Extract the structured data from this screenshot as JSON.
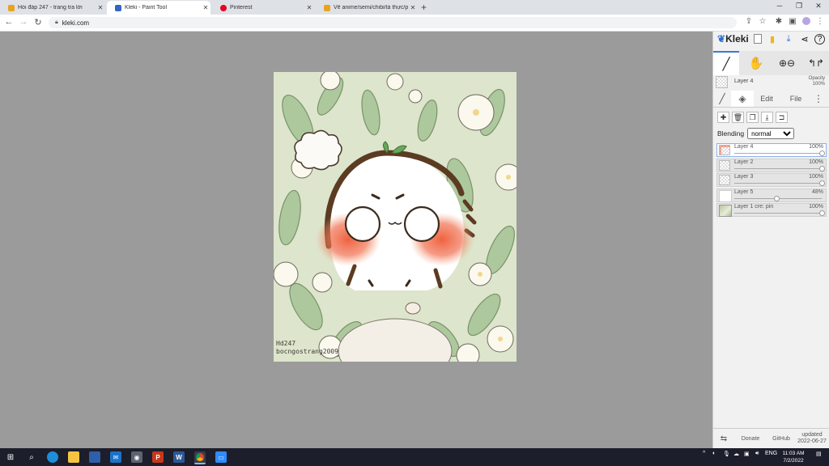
{
  "browser": {
    "tabs": [
      {
        "title": "Hỏi đáp 247 - trang tra lời",
        "favicon_color": "#e8a322"
      },
      {
        "title": "Kleki - Paint Tool",
        "favicon_color": "#3466c2"
      },
      {
        "title": "Pinterest",
        "favicon_color": "#e60023"
      },
      {
        "title": "Vẽ anime/semi/chibi/tả thực/ph...",
        "favicon_color": "#e8a322"
      }
    ],
    "url": "kleki.com"
  },
  "artwork": {
    "credit_line1": "Hd247",
    "credit_line2": "bocngostrang2009"
  },
  "panel": {
    "logo": "Kleki",
    "current_layer_name": "Layer 4",
    "opacity_label": "Opacity",
    "opacity_value": "100%",
    "tabs": [
      "Edit",
      "File"
    ],
    "blending_label": "Blending",
    "blending_value": "normal",
    "layers": [
      {
        "name": "Layer 4",
        "opacity": "100%",
        "opacity_value": 1.0,
        "selected": true,
        "thumb": "sketch"
      },
      {
        "name": "Layer 2",
        "opacity": "100%",
        "opacity_value": 1.0,
        "selected": false,
        "thumb": "transparent"
      },
      {
        "name": "Layer 3",
        "opacity": "100%",
        "opacity_value": 1.0,
        "selected": false,
        "thumb": "transparent"
      },
      {
        "name": "Layer 5",
        "opacity": "48%",
        "opacity_value": 0.48,
        "selected": false,
        "thumb": "white"
      },
      {
        "name": "Layer 1 cre: pin",
        "opacity": "100%",
        "opacity_value": 1.0,
        "selected": false,
        "thumb": "image"
      }
    ],
    "footer": {
      "donate": "Donate",
      "github": "GitHub",
      "updated_line1": "updated",
      "updated_line2": "2022-06-27"
    }
  },
  "taskbar": {
    "language": "ENG",
    "time": "11:03 AM",
    "date": "7/2/2022"
  },
  "colors": {
    "accent": "#3d78d8",
    "blush": "#ef5a35",
    "taskbar": "#1c1e2b"
  }
}
